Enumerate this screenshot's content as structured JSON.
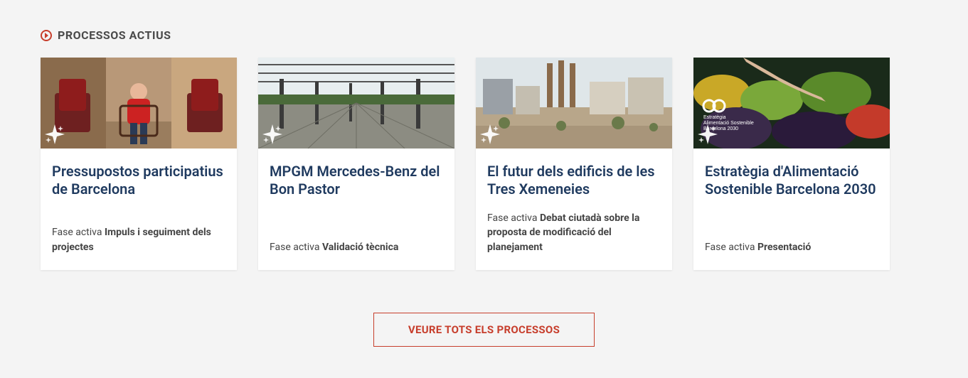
{
  "section": {
    "title": "PROCESSOS ACTIUS",
    "icon_color": "#c73e2c"
  },
  "phase_label": "Fase activa",
  "cards": [
    {
      "title": "Pressupostos participatius de Barcelona",
      "phase": "Impuls i seguiment dels projectes",
      "image": "chairs"
    },
    {
      "title": "MPGM Mercedes-Benz del Bon Pastor",
      "phase": "Validació tècnica",
      "image": "warehouse"
    },
    {
      "title": "El futur dels edificis de les Tres Xemeneies",
      "phase": "Debat ciutadà sobre la proposta de modificació del planejament",
      "image": "chimneys"
    },
    {
      "title": "Estratègia d'Alimentació Sostenible Barcelona 2030",
      "phase": "Presentació",
      "image": "market"
    }
  ],
  "footer_button": "VEURE TOTS ELS PROCESSOS"
}
